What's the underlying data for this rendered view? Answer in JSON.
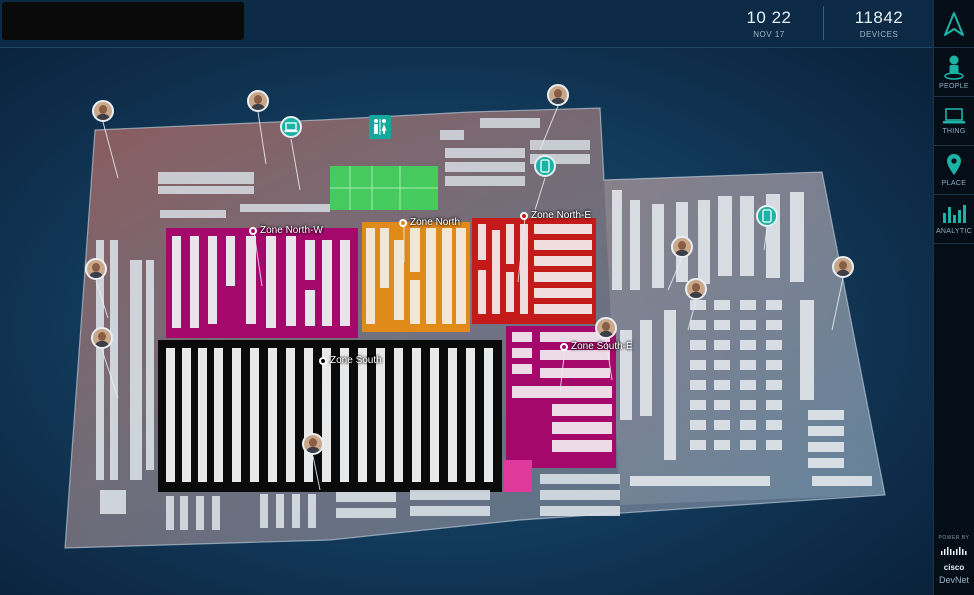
{
  "header": {
    "time": "10 22",
    "date": "NOV 17",
    "devices_count": "11842",
    "devices_label": "DEVICES"
  },
  "rail": {
    "items": [
      {
        "label": "PEOPLE",
        "icon": "person-icon"
      },
      {
        "label": "THING",
        "icon": "laptop-icon"
      },
      {
        "label": "PLACE",
        "icon": "map-pin-icon"
      },
      {
        "label": "ANALYTIC",
        "icon": "bar-chart-icon"
      }
    ],
    "powered_by": "POWER BY",
    "brand": "cisco",
    "brand_sub": "DevNet"
  },
  "zones": [
    {
      "name": "Zone North-W",
      "color": "#a3086a"
    },
    {
      "name": "Zone North",
      "color": "#e08a1a"
    },
    {
      "name": "Zone North-E",
      "color": "#c41a1a"
    },
    {
      "name": "Zone South",
      "color": "#0a0a0a"
    },
    {
      "name": "Zone South-E",
      "color": "#a3086a"
    }
  ],
  "colors": {
    "accent": "#1bb3a6",
    "restroom_zone": "#3ddc5a",
    "heat": "#c26a5a"
  }
}
